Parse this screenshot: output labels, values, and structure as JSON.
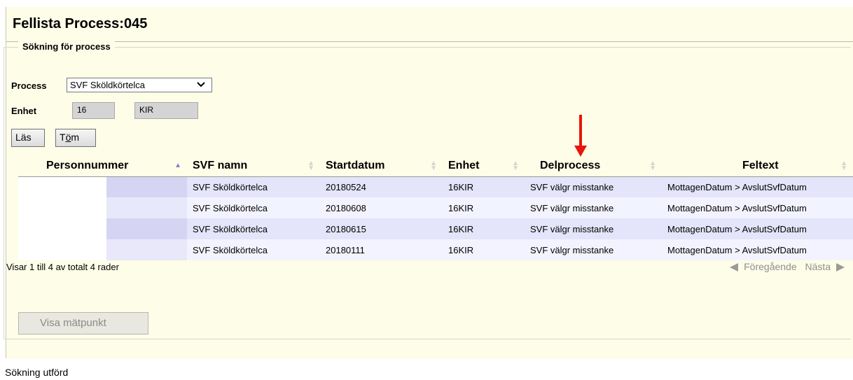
{
  "header": {
    "title": "Fellista Process:045"
  },
  "search": {
    "legend": "Sökning för process",
    "process_label": "Process",
    "process_value": "SVF Sköldkörtelca",
    "enhet_label": "Enhet",
    "enhet_code": "16",
    "enhet_name": "KIR",
    "read_button": "Läs",
    "clear_button_prefix": "T",
    "clear_button_underlined": "ö",
    "clear_button_suffix": "m"
  },
  "table": {
    "columns": [
      "Personnummer",
      "SVF namn",
      "Startdatum",
      "Enhet",
      "Delprocess",
      "Feltext"
    ],
    "rows": [
      [
        "",
        "SVF Sköldkörtelca",
        "20180524",
        "16KIR",
        "SVF välgr misstanke",
        "MottagenDatum > AvslutSvfDatum"
      ],
      [
        "",
        "SVF Sköldkörtelca",
        "20180608",
        "16KIR",
        "SVF välgr misstanke",
        "MottagenDatum > AvslutSvfDatum"
      ],
      [
        "",
        "SVF Sköldkörtelca",
        "20180615",
        "16KIR",
        "SVF välgr misstanke",
        "MottagenDatum > AvslutSvfDatum"
      ],
      [
        "",
        "SVF Sköldkörtelca",
        "20180111",
        "16KIR",
        "SVF välgr misstanke",
        "MottagenDatum > AvslutSvfDatum"
      ]
    ],
    "info": "Visar 1 till 4 av totalt 4 rader",
    "prev": "Föregående",
    "next": "Nästa"
  },
  "actions": {
    "visa_button": "Visa mätpunkt"
  },
  "status": "Sökning utförd",
  "colors": {
    "annotation_arrow": "#e8150a",
    "row_odd": "#e4e4fa",
    "row_even": "#f3f3ff",
    "panel_bg": "#fdfde8"
  },
  "icons": [
    "chevron-down-icon",
    "sort-icon",
    "prev-arrow-icon",
    "next-arrow-icon",
    "red-arrow-icon"
  ]
}
